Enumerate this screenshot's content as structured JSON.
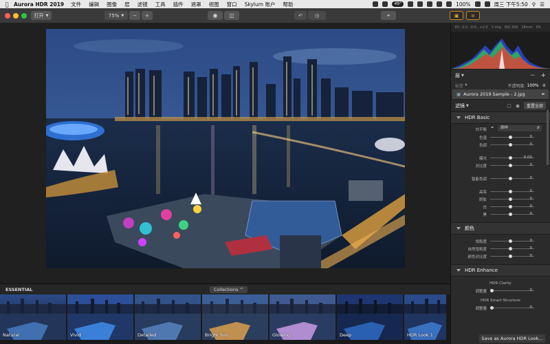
{
  "menubar": {
    "app_name": "Aurora HDR 2019",
    "items": [
      "文件",
      "编辑",
      "图像",
      "层",
      "滤镜",
      "工具",
      "插件",
      "遮罩",
      "视图",
      "窗口",
      "Skylum 账户",
      "帮助"
    ],
    "temperature": "49°",
    "battery": "100%",
    "clock": "周三 下午5:50"
  },
  "toolbar": {
    "open_label": "打开",
    "zoom_value": "75%",
    "zoom_out": "−",
    "zoom_in": "+"
  },
  "filmstrip": {
    "category": "ESSENTIAL",
    "collections_label": "Collections ^",
    "presets": [
      "Natural",
      "Vivid",
      "Detailed",
      "Bright Sun",
      "Glowing",
      "Deep",
      "HDR Look 1"
    ]
  },
  "panel": {
    "meta": [
      "EV -2.0...0.0...+2.0",
      "3 img",
      "ISO 200",
      "24mm",
      "f/4"
    ],
    "layers_label": "层",
    "mask_label": "标签",
    "opacity_label": "不透明度:",
    "opacity_value": "100%",
    "layer_name": "Aurora 2019 Sample - 2.jpg",
    "filters_label": "滤镜",
    "reset_all": "重置全部",
    "hdr_basic": {
      "title": "HDR Basic",
      "wb_label": "白平衡",
      "wb_value": "原样",
      "sliders": [
        {
          "label": "色温",
          "value": "0"
        },
        {
          "label": "色调",
          "value": "0"
        },
        {
          "label": "曝光",
          "value": "0.00"
        },
        {
          "label": "对比度",
          "value": "0"
        },
        {
          "label": "智能色调",
          "value": "0"
        },
        {
          "label": "高亮",
          "value": "0"
        },
        {
          "label": "阴影",
          "value": "0"
        },
        {
          "label": "白",
          "value": "0"
        },
        {
          "label": "黑",
          "value": "0"
        }
      ]
    },
    "color": {
      "title": "颜色",
      "sliders": [
        {
          "label": "饱和度",
          "value": "0"
        },
        {
          "label": "自然饱和度",
          "value": "0"
        },
        {
          "label": "颜色对比度",
          "value": "0"
        }
      ]
    },
    "hdr_enhance": {
      "title": "HDR Enhance",
      "clarity_title": "HDR Clarity",
      "clarity_label": "调整量",
      "clarity_value": "0",
      "structure_title": "HDR Smart Structure",
      "structure_label": "调整量",
      "structure_value": "0"
    },
    "save_button": "Save as Aurora HDR Look..."
  }
}
